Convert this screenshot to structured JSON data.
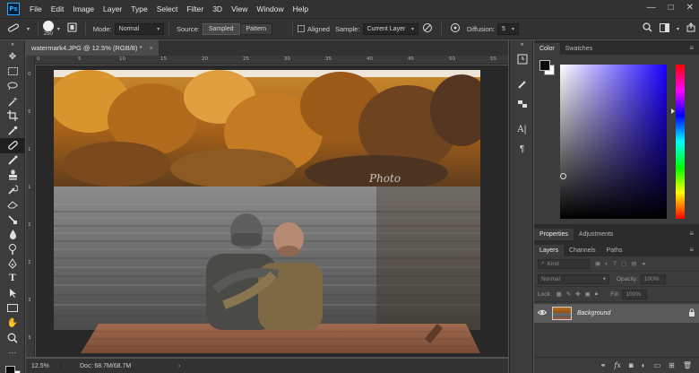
{
  "app": {
    "logo": "Ps"
  },
  "menu": [
    "File",
    "Edit",
    "Image",
    "Layer",
    "Type",
    "Select",
    "Filter",
    "3D",
    "View",
    "Window",
    "Help"
  ],
  "window_controls": {
    "minimize": "—",
    "maximize": "□",
    "close": "✕"
  },
  "options": {
    "brush_size": "250",
    "mode_label": "Mode:",
    "mode_value": "Normal",
    "source_label": "Source:",
    "sampled_label": "Sampled",
    "pattern_label": "Pattern",
    "aligned_label": "Aligned",
    "sample_label": "Sample:",
    "sample_value": "Current Layer",
    "diffusion_label": "Diffusion:",
    "diffusion_value": "5"
  },
  "document": {
    "tab_title": "watermark4.JPG @ 12.5% (RGB/8) *",
    "close_symbol": "×",
    "watermark_text": "Photo",
    "ruler_top": [
      "0",
      "5",
      "10",
      "15",
      "20",
      "25",
      "30",
      "35",
      "40",
      "45",
      "50",
      "55"
    ],
    "ruler_left": [
      "0",
      "5",
      "1",
      "1",
      "2",
      "2",
      "3",
      "3"
    ]
  },
  "status": {
    "zoom": "12.5%",
    "doc_size": "Doc: 68.7M/68.7M",
    "arrow": "›"
  },
  "color_panel": {
    "tabs": [
      "Color",
      "Swatches"
    ],
    "menu": "≡"
  },
  "properties_panel": {
    "tabs": [
      "Properties",
      "Adjustments"
    ],
    "menu": "≡"
  },
  "layers_panel": {
    "tabs": [
      "Layers",
      "Channels",
      "Paths"
    ],
    "menu": "≡",
    "kind_label": "Kind",
    "blend_mode": "Normal",
    "opacity_label": "Opacity:",
    "opacity_value": "100%",
    "lock_label": "Lock:",
    "fill_label": "Fill:",
    "fill_value": "100%",
    "layer_name": "Background"
  }
}
